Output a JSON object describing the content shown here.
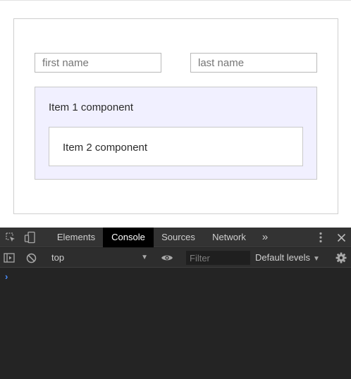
{
  "form": {
    "first_name_placeholder": "first name",
    "last_name_placeholder": "last name"
  },
  "components": {
    "item1_label": "Item 1 component",
    "item2_label": "Item 2 component"
  },
  "devtools": {
    "tabs": [
      "Elements",
      "Console",
      "Sources",
      "Network"
    ],
    "active_tab": "Console",
    "more_tabs_glyph": "»",
    "context": "top",
    "filter_placeholder": "Filter",
    "levels_label": "Default levels",
    "prompt_glyph": "›",
    "icons": [
      "inspect-element-icon",
      "device-toolbar-icon",
      "more-options-icon",
      "close-icon",
      "sidebar-toggle-icon",
      "clear-console-icon",
      "eye-icon",
      "gear-icon"
    ]
  },
  "colors": {
    "item1_background": "#f1f0ff",
    "devtools_background": "#242424",
    "active_tab_background": "#000000",
    "prompt": "#4a8eff"
  }
}
